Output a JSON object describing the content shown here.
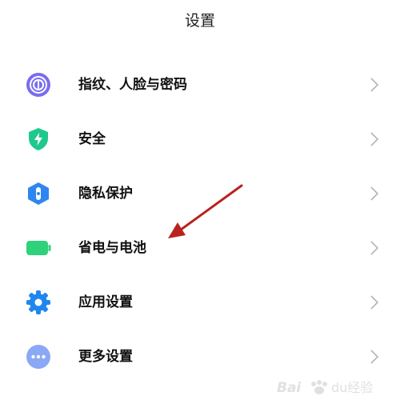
{
  "header": {
    "title": "设置"
  },
  "settings": {
    "items": [
      {
        "label": "指纹、人脸与密码",
        "icon": "fingerprint-icon",
        "color": "#7a6cf0"
      },
      {
        "label": "安全",
        "icon": "shield-icon",
        "color": "#1fc98e"
      },
      {
        "label": "隐私保护",
        "icon": "privacy-icon",
        "color": "#2e86f0"
      },
      {
        "label": "省电与电池",
        "icon": "battery-icon",
        "color": "#2fd27a"
      },
      {
        "label": "应用设置",
        "icon": "gear-icon",
        "color": "#1f86f0"
      },
      {
        "label": "更多设置",
        "icon": "more-icon",
        "color": "#8aa8f5"
      }
    ]
  },
  "annotation": {
    "arrow_color": "#b8231d"
  },
  "watermark": {
    "brand_text": "Baidu经验"
  }
}
